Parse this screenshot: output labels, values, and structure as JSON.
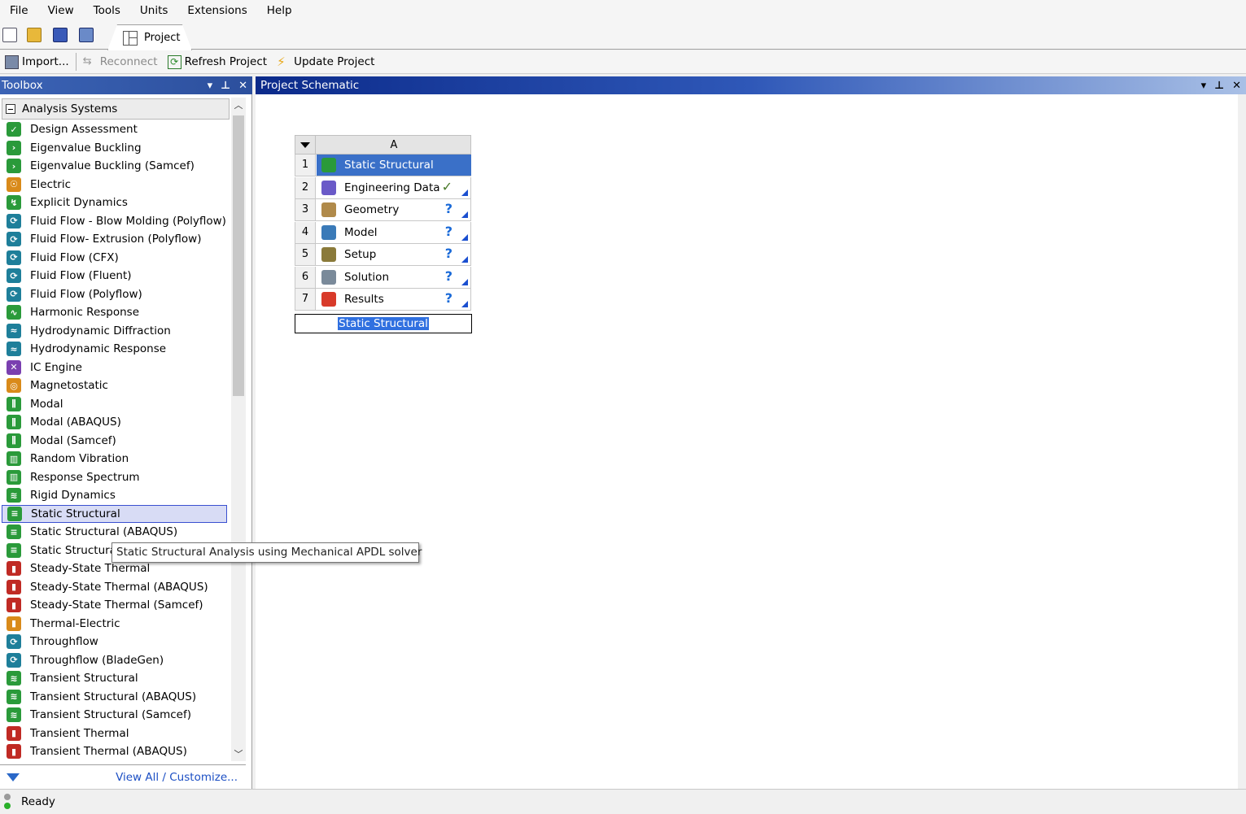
{
  "menu": [
    "File",
    "View",
    "Tools",
    "Units",
    "Extensions",
    "Help"
  ],
  "tabs": {
    "project": "Project"
  },
  "toolbar": {
    "import": "Import...",
    "reconnect": "Reconnect",
    "refresh": "Refresh Project",
    "update": "Update Project"
  },
  "toolbox": {
    "title": "Toolbox",
    "group": "Analysis Systems",
    "items": [
      {
        "label": "Design Assessment",
        "icon": "design-assessment-icon",
        "color": "#2a9a3a",
        "glyph": "✓"
      },
      {
        "label": "Eigenvalue Buckling",
        "icon": "eigenvalue-buckling-icon",
        "color": "#2a9a3a",
        "glyph": "›"
      },
      {
        "label": "Eigenvalue Buckling (Samcef)",
        "icon": "eigenvalue-buckling-icon",
        "color": "#2a9a3a",
        "glyph": "›"
      },
      {
        "label": "Electric",
        "icon": "electric-icon",
        "color": "#d98a1a",
        "glyph": "☉"
      },
      {
        "label": "Explicit Dynamics",
        "icon": "explicit-dynamics-icon",
        "color": "#2a9a3a",
        "glyph": "↯"
      },
      {
        "label": "Fluid Flow - Blow Molding (Polyflow)",
        "icon": "fluid-flow-icon",
        "color": "#1e7f9a",
        "glyph": "⟳"
      },
      {
        "label": "Fluid Flow- Extrusion (Polyflow)",
        "icon": "fluid-flow-icon",
        "color": "#1e7f9a",
        "glyph": "⟳"
      },
      {
        "label": "Fluid Flow (CFX)",
        "icon": "fluid-flow-icon",
        "color": "#1e7f9a",
        "glyph": "⟳"
      },
      {
        "label": "Fluid Flow (Fluent)",
        "icon": "fluid-flow-icon",
        "color": "#1e7f9a",
        "glyph": "⟳"
      },
      {
        "label": "Fluid Flow (Polyflow)",
        "icon": "fluid-flow-icon",
        "color": "#1e7f9a",
        "glyph": "⟳"
      },
      {
        "label": "Harmonic Response",
        "icon": "harmonic-response-icon",
        "color": "#2a9a3a",
        "glyph": "∿"
      },
      {
        "label": "Hydrodynamic Diffraction",
        "icon": "hydrodynamic-diffraction-icon",
        "color": "#1e7f9a",
        "glyph": "≈"
      },
      {
        "label": "Hydrodynamic Response",
        "icon": "hydrodynamic-response-icon",
        "color": "#1e7f9a",
        "glyph": "≈"
      },
      {
        "label": "IC Engine",
        "icon": "ic-engine-icon",
        "color": "#7a3fb0",
        "glyph": "✕"
      },
      {
        "label": "Magnetostatic",
        "icon": "magnetostatic-icon",
        "color": "#d98a1a",
        "glyph": "◎"
      },
      {
        "label": "Modal",
        "icon": "modal-icon",
        "color": "#2a9a3a",
        "glyph": "⫼"
      },
      {
        "label": "Modal (ABAQUS)",
        "icon": "modal-icon",
        "color": "#2a9a3a",
        "glyph": "⫼"
      },
      {
        "label": "Modal (Samcef)",
        "icon": "modal-icon",
        "color": "#2a9a3a",
        "glyph": "⫼"
      },
      {
        "label": "Random Vibration",
        "icon": "random-vibration-icon",
        "color": "#2a9a3a",
        "glyph": "▥"
      },
      {
        "label": "Response Spectrum",
        "icon": "response-spectrum-icon",
        "color": "#2a9a3a",
        "glyph": "▥"
      },
      {
        "label": "Rigid Dynamics",
        "icon": "rigid-dynamics-icon",
        "color": "#2a9a3a",
        "glyph": "≋"
      },
      {
        "label": "Static Structural",
        "icon": "static-structural-icon",
        "color": "#2a9a3a",
        "glyph": "≡"
      },
      {
        "label": "Static Structural (ABAQUS)",
        "icon": "static-structural-icon",
        "color": "#2a9a3a",
        "glyph": "≡"
      },
      {
        "label": "Static Structural (Samcef)",
        "icon": "static-structural-icon",
        "color": "#2a9a3a",
        "glyph": "≡"
      },
      {
        "label": "Steady-State Thermal",
        "icon": "steady-state-thermal-icon",
        "color": "#c02a24",
        "glyph": "▮"
      },
      {
        "label": "Steady-State Thermal (ABAQUS)",
        "icon": "steady-state-thermal-icon",
        "color": "#c02a24",
        "glyph": "▮"
      },
      {
        "label": "Steady-State Thermal (Samcef)",
        "icon": "steady-state-thermal-icon",
        "color": "#c02a24",
        "glyph": "▮"
      },
      {
        "label": "Thermal-Electric",
        "icon": "thermal-electric-icon",
        "color": "#d98a1a",
        "glyph": "▮"
      },
      {
        "label": "Throughflow",
        "icon": "throughflow-icon",
        "color": "#1e7f9a",
        "glyph": "⟳"
      },
      {
        "label": "Throughflow (BladeGen)",
        "icon": "throughflow-icon",
        "color": "#1e7f9a",
        "glyph": "⟳"
      },
      {
        "label": "Transient Structural",
        "icon": "transient-structural-icon",
        "color": "#2a9a3a",
        "glyph": "≋"
      },
      {
        "label": "Transient Structural (ABAQUS)",
        "icon": "transient-structural-icon",
        "color": "#2a9a3a",
        "glyph": "≋"
      },
      {
        "label": "Transient Structural (Samcef)",
        "icon": "transient-structural-icon",
        "color": "#2a9a3a",
        "glyph": "≋"
      },
      {
        "label": "Transient Thermal",
        "icon": "transient-thermal-icon",
        "color": "#c02a24",
        "glyph": "▮"
      },
      {
        "label": "Transient Thermal (ABAQUS)",
        "icon": "transient-thermal-icon",
        "color": "#c02a24",
        "glyph": "▮"
      }
    ],
    "selected_index": 21,
    "footer_link": "View All / Customize..."
  },
  "schematic": {
    "title": "Project Schematic",
    "system": {
      "column": "A",
      "name": "Static Structural",
      "rows": [
        {
          "num": "1",
          "label": "Static Structural",
          "status": "",
          "icon": "static-structural-icon",
          "color": "#2a9a3a"
        },
        {
          "num": "2",
          "label": "Engineering Data",
          "status": "✓",
          "icon": "engineering-data-icon",
          "color": "#6a5ac8"
        },
        {
          "num": "3",
          "label": "Geometry",
          "status": "?",
          "icon": "geometry-icon",
          "color": "#b08a4a"
        },
        {
          "num": "4",
          "label": "Model",
          "status": "?",
          "icon": "model-icon",
          "color": "#3a7ab8"
        },
        {
          "num": "5",
          "label": "Setup",
          "status": "?",
          "icon": "setup-icon",
          "color": "#8a7a3a"
        },
        {
          "num": "6",
          "label": "Solution",
          "status": "?",
          "icon": "solution-icon",
          "color": "#7a8a9a"
        },
        {
          "num": "7",
          "label": "Results",
          "status": "?",
          "icon": "results-icon",
          "color": "#d83a2a"
        }
      ]
    }
  },
  "tooltip": "Static Structural Analysis using Mechanical APDL solver",
  "status": {
    "text": "Ready"
  }
}
